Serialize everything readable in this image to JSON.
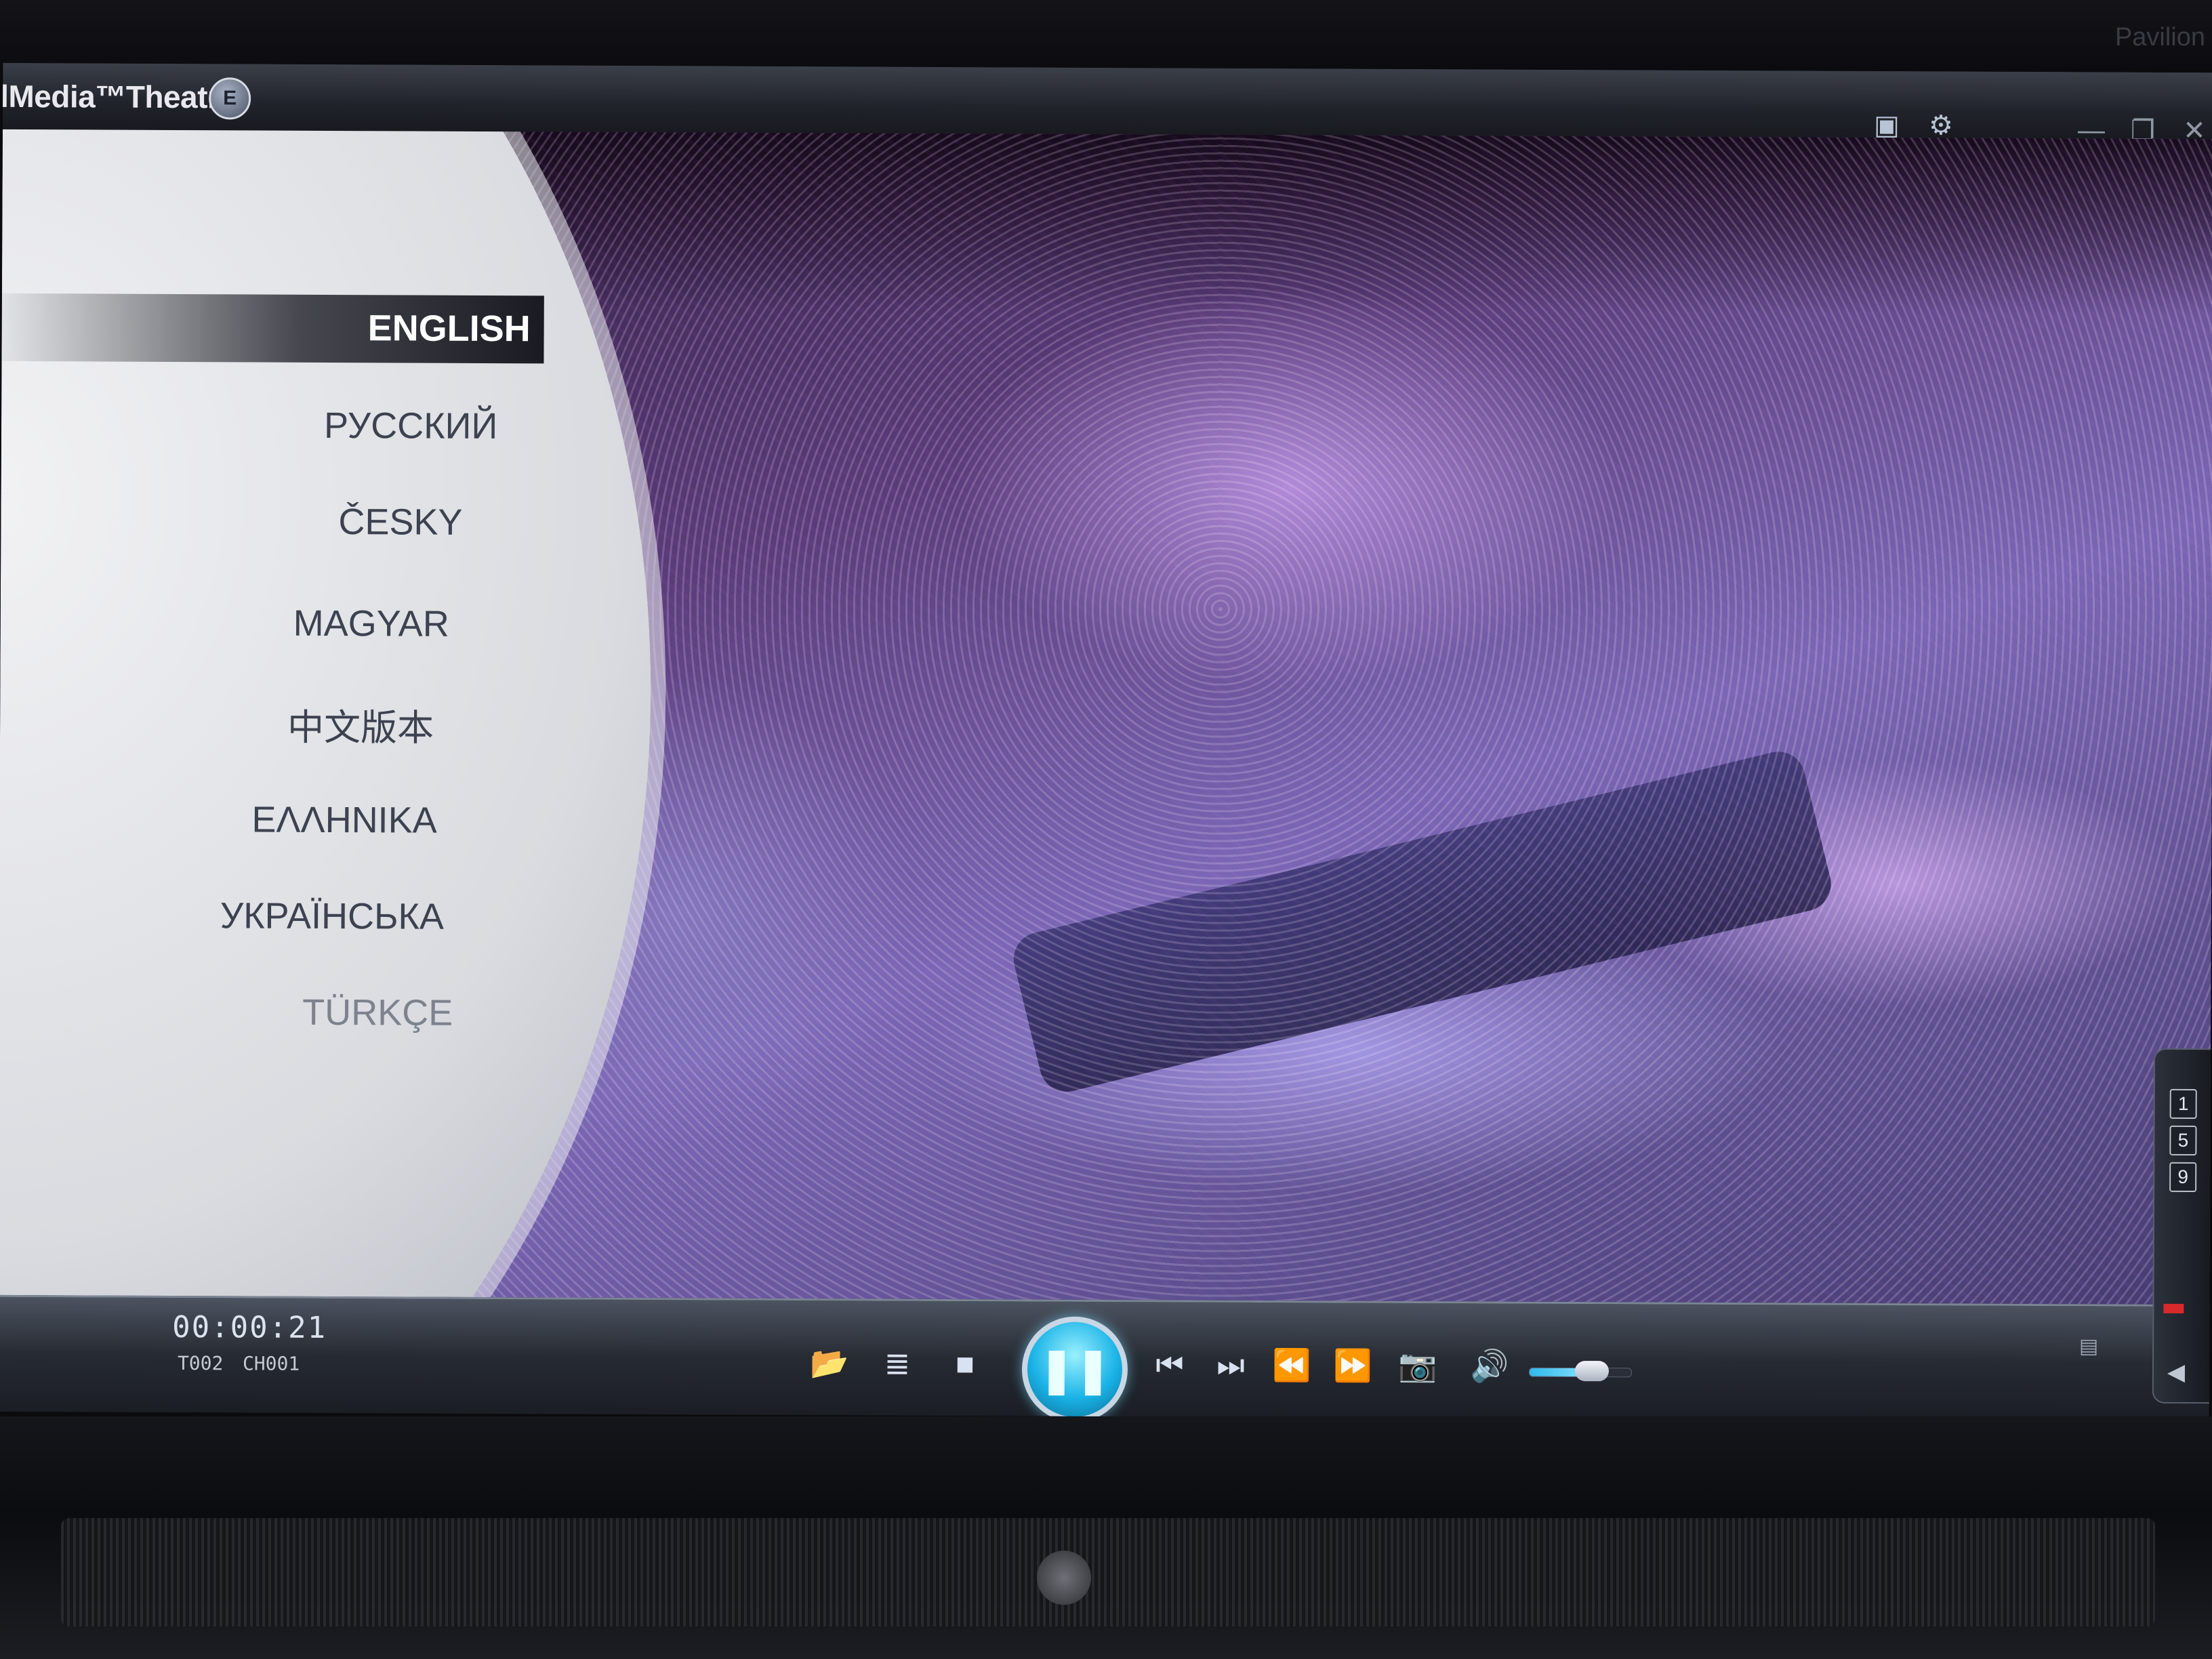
{
  "device": {
    "brand": "Pavilion"
  },
  "titlebar": {
    "app_title": "lMedia™Theatre",
    "edition_badge": "E",
    "icons": [
      "toolbox-icon",
      "settings-gear-icon"
    ],
    "window_buttons": {
      "minimize": "—",
      "restore": "❐",
      "close": "✕"
    }
  },
  "menu": {
    "languages": [
      {
        "label": "ENGLISH",
        "selected": true
      },
      {
        "label": "РУССКИЙ",
        "selected": false
      },
      {
        "label": "ČESKY",
        "selected": false
      },
      {
        "label": "MAGYAR",
        "selected": false
      },
      {
        "label": "中文版本",
        "selected": false
      },
      {
        "label": "ΕΛΛΗΝΙΚΑ",
        "selected": false
      },
      {
        "label": "УКРАЇНСЬКА",
        "selected": false
      },
      {
        "label": "TÜRKÇE",
        "selected": false
      }
    ]
  },
  "controls": {
    "time": "00:00:21",
    "title_label": "T",
    "title_number": "002",
    "chapter_label": "CH",
    "chapter_number": "001",
    "buttons": [
      "open-folder-icon",
      "playlist-icon",
      "stop-icon",
      "pause-icon",
      "previous-icon",
      "next-icon",
      "rewind-icon",
      "fast-forward-icon",
      "snapshot-camera-icon",
      "volume-icon"
    ],
    "volume_level": 0.62,
    "accent_color": "#1ab3e6"
  },
  "side_panel": {
    "numbers": [
      "1",
      "5",
      "9"
    ]
  }
}
